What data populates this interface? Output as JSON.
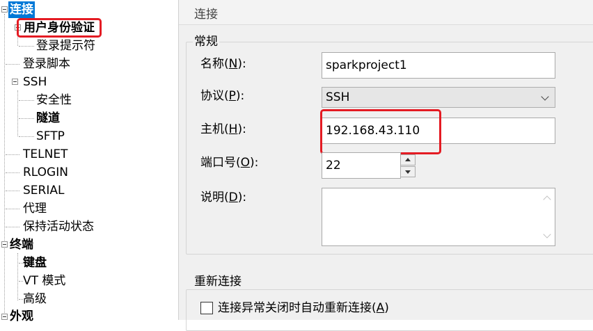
{
  "tree": {
    "items": [
      {
        "label": "连接"
      },
      {
        "label": "用户身份验证"
      },
      {
        "label": "登录提示符"
      },
      {
        "label": "登录脚本"
      },
      {
        "label": "SSH"
      },
      {
        "label": "安全性"
      },
      {
        "label": "隧道"
      },
      {
        "label": "SFTP"
      },
      {
        "label": "TELNET"
      },
      {
        "label": "RLOGIN"
      },
      {
        "label": "SERIAL"
      },
      {
        "label": "代理"
      },
      {
        "label": "保持活动状态"
      },
      {
        "label": "终端"
      },
      {
        "label": "键盘"
      },
      {
        "label": "VT 模式"
      },
      {
        "label": "高级"
      },
      {
        "label": "外观"
      }
    ]
  },
  "panel": {
    "header": "连接",
    "general": {
      "title": "常规",
      "name_label": "名称",
      "name_key": "N",
      "name_value": "sparkproject1",
      "protocol_label": "协议",
      "protocol_key": "P",
      "protocol_value": "SSH",
      "host_label": "主机",
      "host_key": "H",
      "host_value": "192.168.43.110",
      "port_label": "端口号",
      "port_key": "O",
      "port_value": "22",
      "desc_label": "说明",
      "desc_key": "D",
      "desc_value": ""
    },
    "reconnect": {
      "title": "重新连接",
      "checkbox_label": "连接异常关闭时自动重新连接",
      "checkbox_key": "A",
      "checked": false
    }
  },
  "colors": {
    "selection": "#0078d7",
    "highlight_box": "#e41b23"
  }
}
